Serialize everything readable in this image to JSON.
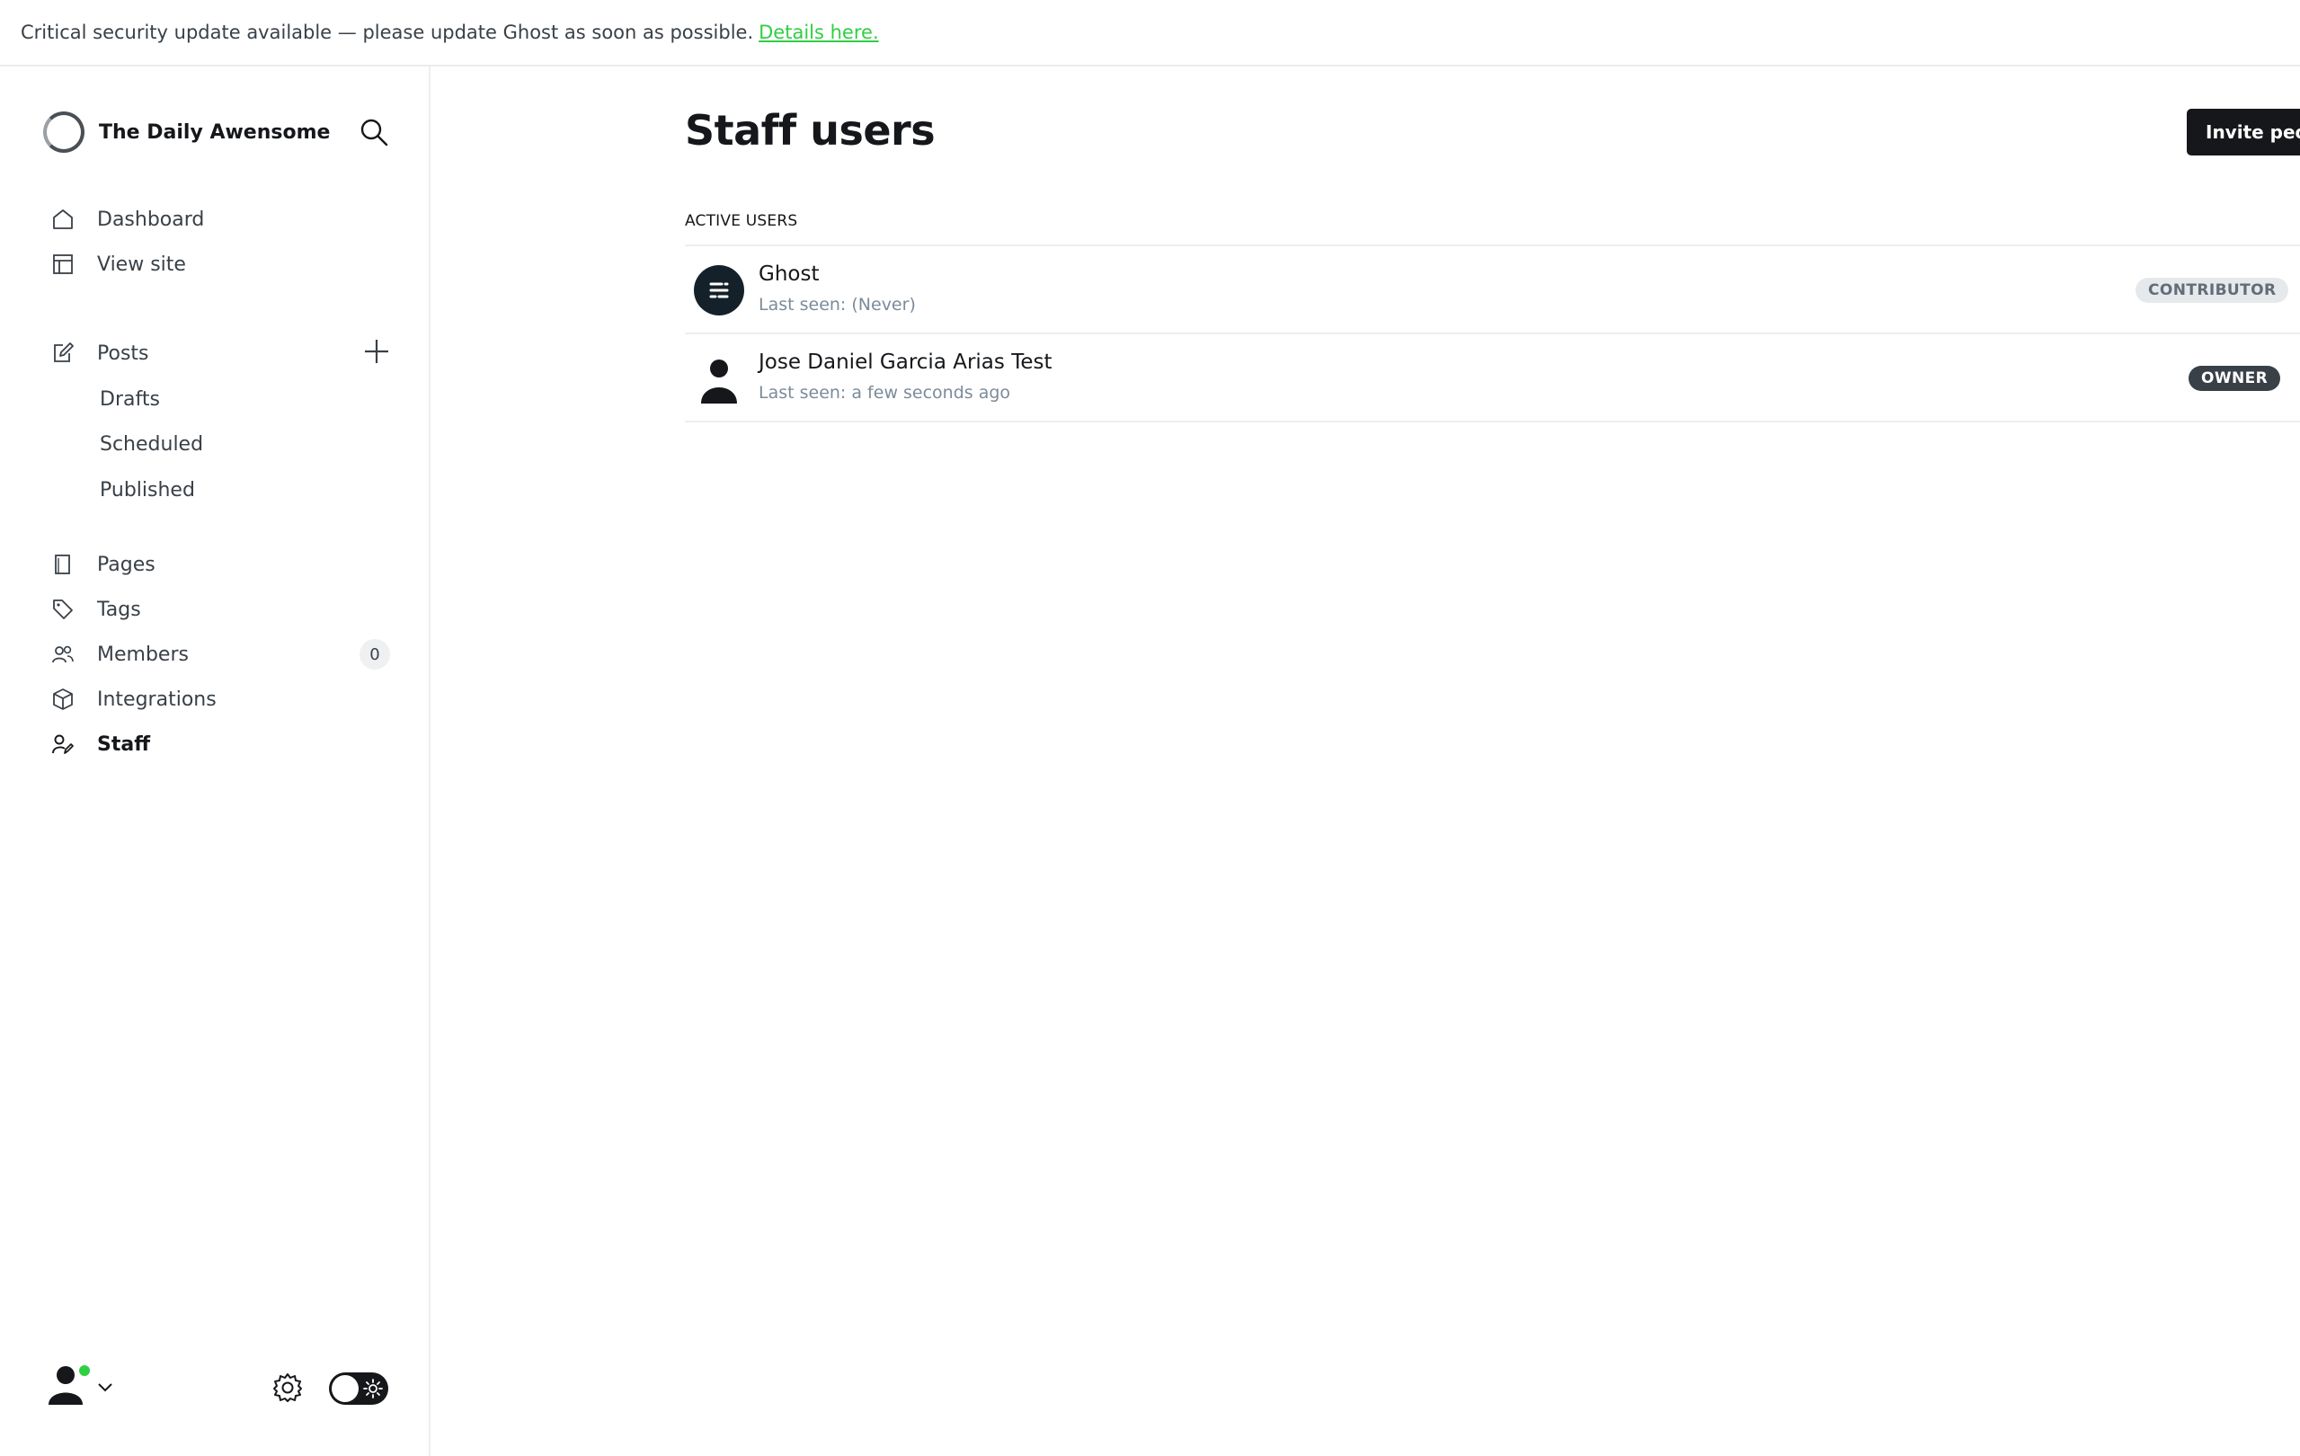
{
  "banner": {
    "message": "Critical security update available — please update Ghost as soon as possible.",
    "link_text": "Details here."
  },
  "brand": {
    "title": "The Daily Awensome"
  },
  "nav": {
    "dashboard": "Dashboard",
    "view_site": "View site",
    "posts": "Posts",
    "drafts": "Drafts",
    "scheduled": "Scheduled",
    "published": "Published",
    "pages": "Pages",
    "tags": "Tags",
    "members": "Members",
    "members_count": "0",
    "integrations": "Integrations",
    "staff": "Staff"
  },
  "main": {
    "title": "Staff users",
    "invite_button": "Invite people",
    "section_label": "ACTIVE USERS",
    "users": [
      {
        "name": "Ghost",
        "last_seen": "Last seen: (Never)",
        "role": "CONTRIBUTOR"
      },
      {
        "name": "Jose Daniel Garcia Arias Test",
        "last_seen": "Last seen: a few seconds ago",
        "role": "OWNER"
      }
    ]
  },
  "colors": {
    "accent_green": "#30cf43",
    "dark": "#15171a",
    "owner_badge": "#394047",
    "contributor_badge": "#e6e9eb"
  },
  "icons": [
    "search-icon",
    "home-icon",
    "layout-icon",
    "edit-icon",
    "plus-icon",
    "page-icon",
    "tag-icon",
    "members-icon",
    "cube-icon",
    "staff-icon",
    "user-icon",
    "chevron-down-icon",
    "gear-icon",
    "sun-icon"
  ]
}
